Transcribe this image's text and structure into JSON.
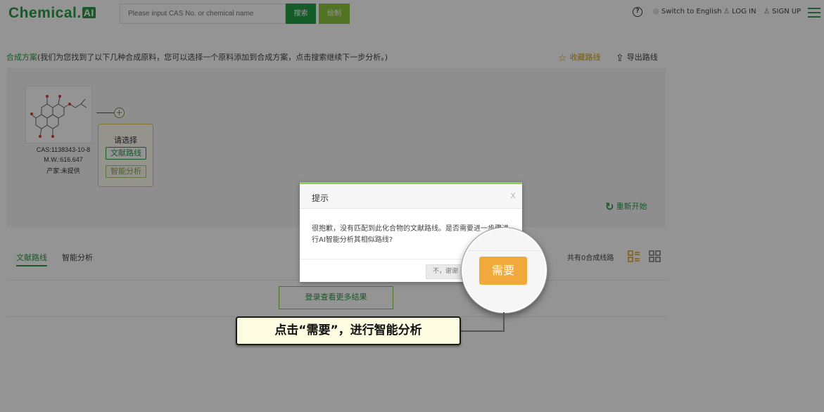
{
  "header": {
    "logo_text": "Chemical.",
    "logo_badge": "AI",
    "search_placeholder": "Please input CAS No. or chemical name",
    "search_button": "搜索",
    "draw_button": "绘制",
    "help_icon": "?",
    "switch_language": "Switch to English",
    "login": "LOG IN",
    "signup": "SIGN UP"
  },
  "route": {
    "title_prefix": "合成方案",
    "title_text": "(我们为您找到了以下几种合成原料，您可以选择一个原料添加到合成方案，点击搜索继续下一步分析。)",
    "favorite": "收藏路线",
    "export": "导出路线",
    "restart": "重新开始"
  },
  "molecule": {
    "cas": "CAS:1138343-10-8",
    "mw": "M.W.:616.647",
    "source": "产家:未提供"
  },
  "select_box": {
    "title": "请选择",
    "option_literature": "文献路线",
    "option_ai": "智能分析"
  },
  "tabs": {
    "literature": "文献路线",
    "ai": "智能分析"
  },
  "results": {
    "count_text": "共有0合成线路",
    "login_more": "登录查看更多结果"
  },
  "dialog": {
    "title": "提示",
    "close": "x",
    "message": "很抱歉，没有匹配到此化合物的文献路线。是否需要进一步骤进行AI智能分析其相似路线?",
    "no_button": "不，谢谢",
    "yes_button": "需要"
  },
  "callout": {
    "text": "点击“需要”，进行智能分析"
  },
  "colors": {
    "brand_green": "#2b9a48",
    "light_green": "#8ec63f",
    "need_orange": "#f0a93a",
    "callout_bg": "#fefce0"
  }
}
